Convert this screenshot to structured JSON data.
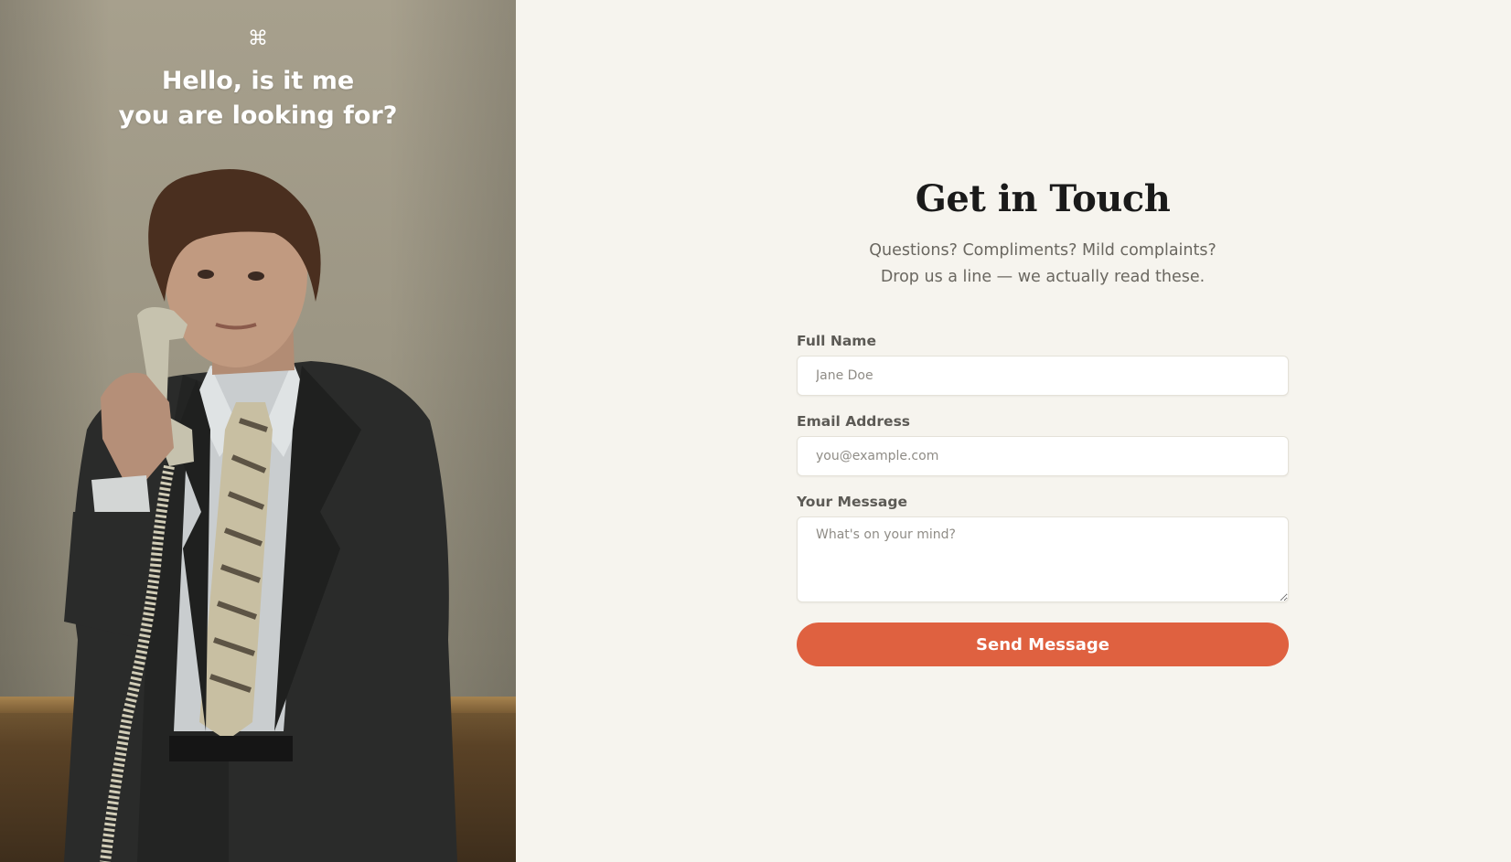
{
  "hero": {
    "brand_icon": "⌘",
    "brand_icon_name": "command-key-icon",
    "headline_line1": "Hello, is it me",
    "headline_line2": "you are looking for?",
    "photo_description_icon": "man-on-telephone-photo"
  },
  "contact": {
    "title": "Get in Touch",
    "subtitle_line1": "Questions? Compliments? Mild complaints?",
    "subtitle_line2": "Drop us a line — we actually read these.",
    "fields": {
      "name": {
        "label": "Full Name",
        "placeholder": "Jane Doe",
        "value": ""
      },
      "email": {
        "label": "Email Address",
        "placeholder": "you@example.com",
        "value": ""
      },
      "message": {
        "label": "Your Message",
        "placeholder": "What's on your mind?",
        "value": ""
      }
    },
    "submit_label": "Send Message"
  },
  "colors": {
    "background": "#f6f4ee",
    "accent": "#df6140",
    "title_text": "#1a1a1a",
    "muted_text": "#6a6760"
  }
}
